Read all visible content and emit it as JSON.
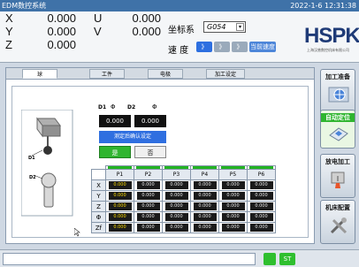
{
  "titlebar": {
    "app_title": "EDM数控系统",
    "datetime": "2022-1-6 12:31:38"
  },
  "coords": {
    "x": {
      "axis": "X",
      "value": "0.000"
    },
    "y": {
      "axis": "Y",
      "value": "0.000"
    },
    "z": {
      "axis": "Z",
      "value": "0.000"
    },
    "u": {
      "axis": "U",
      "value": "0.000"
    },
    "v": {
      "axis": "V",
      "value": "0.000"
    }
  },
  "coordsys": {
    "label": "坐标系",
    "selected": "G054"
  },
  "speed": {
    "label": "速 度",
    "btn_fastest": "》",
    "btn_mid": "》",
    "btn_slow": "》",
    "btn_custom": "当前速度"
  },
  "logo": {
    "text": "HSPK",
    "subtitle": "上海汉普数控机床有限公司"
  },
  "tabs": [
    "球",
    "工件",
    "电极",
    "加工设定"
  ],
  "probe": {
    "d1_label": "D1",
    "d2_label": "D2",
    "d1_value": "0.000",
    "d2_value": "0.000",
    "prompt": "测定后确认设定",
    "yes": "是",
    "no": "否",
    "diagram_d1": "D1",
    "diagram_d2": "D2"
  },
  "grid": {
    "columns": [
      "P1",
      "P2",
      "P3",
      "P4",
      "P5",
      "P6"
    ],
    "rows": [
      {
        "label": "X",
        "values": [
          "0.000",
          "0.000",
          "0.000",
          "0.000",
          "0.000",
          "0.000"
        ]
      },
      {
        "label": "Y",
        "values": [
          "0.000",
          "0.000",
          "0.000",
          "0.000",
          "0.000",
          "0.000"
        ]
      },
      {
        "label": "Z",
        "values": [
          "0.000",
          "0.000",
          "0.000",
          "0.000",
          "0.000",
          "0.000"
        ]
      },
      {
        "label": "Φ",
        "values": [
          "0.000",
          "0.000",
          "0.000",
          "0.000",
          "0.000",
          "0.000"
        ]
      },
      {
        "label": "Zf",
        "values": [
          "0.000",
          "0.000",
          "0.000",
          "0.000",
          "0.000",
          "0.000"
        ]
      }
    ]
  },
  "sidebar": {
    "items": [
      {
        "label": "加工准备"
      },
      {
        "label": "自动定位"
      },
      {
        "label": "放电加工"
      },
      {
        "label": "机床配置"
      }
    ]
  },
  "statusbar": {
    "st_label": "ST"
  },
  "colors": {
    "titlebar": "#3f72a8",
    "active_green": "#2fb52f",
    "value_yellow": "#ffde00",
    "prompt_blue": "#2f6fe0"
  }
}
